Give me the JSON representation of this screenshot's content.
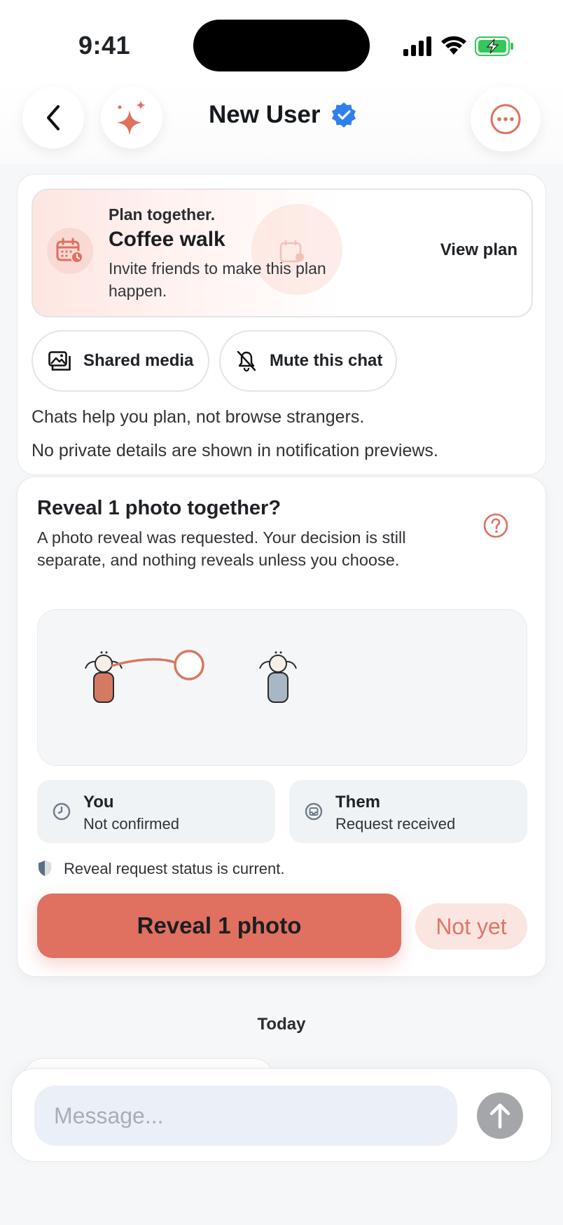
{
  "status_bar": {
    "time": "9:41"
  },
  "header": {
    "title": "New User"
  },
  "plan": {
    "kicker": "Plan together.",
    "name": "Coffee walk",
    "description": "Invite friends to make this plan happen.",
    "action": "View plan"
  },
  "chat_actions": {
    "shared_media": "Shared media",
    "mute": "Mute this chat"
  },
  "notes": {
    "line1": "Chats help you plan, not browse strangers.",
    "line2": "No private details are shown in notification previews."
  },
  "reveal": {
    "title": "Reveal 1 photo together?",
    "description": "A photo reveal was requested. Your decision is still separate, and nothing reveals unless you choose.",
    "you": {
      "who": "You",
      "state": "Not confirmed"
    },
    "them": {
      "who": "Them",
      "state": "Request received"
    },
    "status_line": "Reveal request status is current.",
    "primary_label": "Reveal 1 photo",
    "secondary_label": "Not yet"
  },
  "timeline": {
    "day_label": "Today"
  },
  "composer": {
    "placeholder": "Message..."
  },
  "colors": {
    "accent": "#e07060",
    "verified": "#2f80ed",
    "battery": "#34c759"
  }
}
